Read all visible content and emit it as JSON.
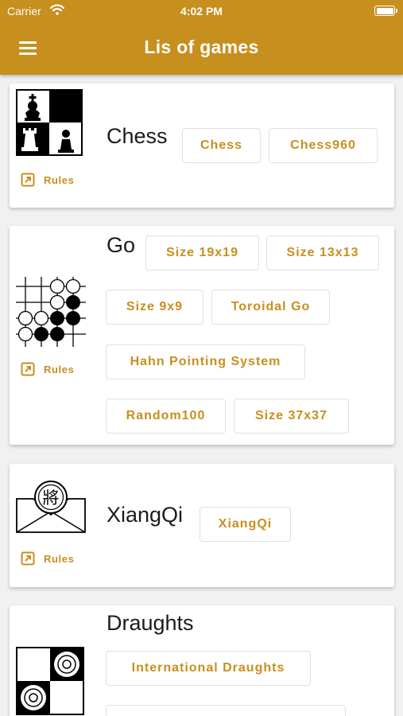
{
  "status_bar": {
    "carrier": "Carrier",
    "time": "4:02 PM"
  },
  "app_bar": {
    "title": "Lis of games",
    "menu_icon": "hamburger-menu-icon"
  },
  "colors": {
    "accent": "#c78f1e",
    "background": "#f1f1f1",
    "card": "#ffffff",
    "text": "#1c1c1c"
  },
  "games": [
    {
      "name": "Chess",
      "rules_label": "Rules",
      "rules_icon": "open-external-icon",
      "variants": [
        "Chess",
        "Chess960"
      ]
    },
    {
      "name": "Go",
      "rules_label": "Rules",
      "rules_icon": "open-external-icon",
      "variants": [
        "Size 19x19",
        "Size 13x13",
        "Size 9x9",
        "Toroidal Go",
        "Hahn Pointing System",
        "Random100",
        "Size 37x37"
      ]
    },
    {
      "name": "XiangQi",
      "rules_label": "Rules",
      "rules_icon": "open-external-icon",
      "thumb_glyph": "將",
      "variants": [
        "XiangQi"
      ]
    },
    {
      "name": "Draughts",
      "variants": [
        "International Draughts"
      ]
    }
  ]
}
